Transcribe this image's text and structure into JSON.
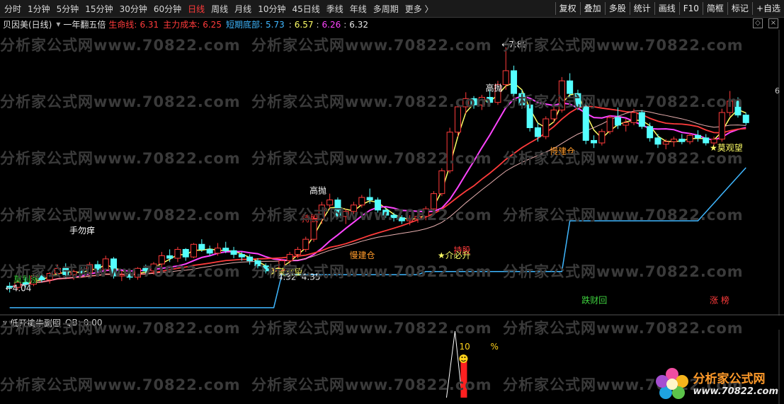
{
  "toolbar": {
    "periods": [
      "分时",
      "1分钟",
      "5分钟",
      "15分钟",
      "30分钟",
      "60分钟",
      "日线",
      "周线",
      "月线",
      "10分钟",
      "45日线",
      "季线",
      "年线",
      "多周期",
      "更多 〉"
    ],
    "active_period": "日线",
    "tools": [
      "复权",
      "叠加",
      "多股",
      "统计",
      "画线",
      "F10",
      "简框",
      "标记",
      "+自选"
    ]
  },
  "legend": {
    "title": "贝因美(日线)",
    "indicator": "一年翻五倍",
    "items": [
      {
        "label": "生命线:",
        "value": "6.31",
        "color": "#ff3b3b"
      },
      {
        "label": "主力成本:",
        "value": "6.25",
        "color": "#ff3b3b"
      },
      {
        "label": "短期底部:",
        "value": "5.73",
        "color": "#3fb7ff"
      }
    ],
    "extra_values": [
      {
        "value": "6.57",
        "color": "#ffff66"
      },
      {
        "value": "6.26",
        "color": "#ff44ff"
      },
      {
        "value": "6.32",
        "color": "#e8e8e8"
      }
    ]
  },
  "sub_legend": {
    "title": "低开擒牛副图",
    "label": "QB:",
    "value": "0.00"
  },
  "watermark": "分析家公式网www.70822.com",
  "logo": {
    "name": "分析家公式网",
    "url": "www.70822.com"
  },
  "right_axis_label": "6",
  "chart_data": {
    "type": "candlestick",
    "ylim": [
      3.7,
      8.1
    ],
    "candles": [
      [
        4.12,
        4.18,
        4.02,
        4.1
      ],
      [
        4.1,
        4.22,
        4.06,
        4.18
      ],
      [
        4.18,
        4.26,
        4.1,
        4.15
      ],
      [
        4.15,
        4.3,
        4.12,
        4.28
      ],
      [
        4.28,
        4.36,
        4.18,
        4.22
      ],
      [
        4.22,
        4.34,
        4.16,
        4.32
      ],
      [
        4.32,
        4.46,
        4.28,
        4.4
      ],
      [
        4.4,
        4.48,
        4.24,
        4.3
      ],
      [
        4.3,
        4.38,
        4.22,
        4.35
      ],
      [
        4.35,
        4.42,
        4.28,
        4.33
      ],
      [
        4.33,
        4.5,
        4.3,
        4.46
      ],
      [
        4.46,
        4.52,
        4.34,
        4.38
      ],
      [
        4.38,
        4.6,
        4.34,
        4.55
      ],
      [
        4.55,
        4.58,
        4.24,
        4.28
      ],
      [
        4.28,
        4.36,
        4.2,
        4.3
      ],
      [
        4.3,
        4.34,
        4.22,
        4.26
      ],
      [
        4.26,
        4.42,
        4.22,
        4.4
      ],
      [
        4.4,
        4.46,
        4.32,
        4.36
      ],
      [
        4.36,
        4.5,
        4.3,
        4.47
      ],
      [
        4.47,
        4.66,
        4.42,
        4.6
      ],
      [
        4.6,
        4.7,
        4.5,
        4.56
      ],
      [
        4.56,
        4.74,
        4.5,
        4.7
      ],
      [
        4.7,
        4.72,
        4.52,
        4.58
      ],
      [
        4.58,
        4.8,
        4.56,
        4.78
      ],
      [
        4.78,
        4.86,
        4.66,
        4.7
      ],
      [
        4.7,
        4.76,
        4.6,
        4.64
      ],
      [
        4.64,
        4.8,
        4.6,
        4.72
      ],
      [
        4.72,
        4.82,
        4.64,
        4.68
      ],
      [
        4.68,
        4.74,
        4.56,
        4.62
      ],
      [
        4.62,
        4.66,
        4.52,
        4.58
      ],
      [
        4.58,
        4.62,
        4.46,
        4.52
      ],
      [
        4.52,
        4.56,
        4.4,
        4.44
      ],
      [
        4.44,
        4.48,
        4.32,
        4.36
      ],
      [
        4.36,
        4.4,
        4.28,
        4.37
      ],
      [
        4.37,
        4.55,
        4.35,
        4.52
      ],
      [
        4.52,
        4.66,
        4.48,
        4.62
      ],
      [
        4.62,
        4.74,
        4.56,
        4.7
      ],
      [
        4.7,
        4.9,
        4.66,
        4.86
      ],
      [
        4.86,
        5.22,
        4.82,
        5.18
      ],
      [
        5.18,
        5.45,
        5.1,
        5.4
      ],
      [
        5.4,
        5.58,
        5.34,
        5.48
      ],
      [
        5.48,
        5.52,
        5.18,
        5.22
      ],
      [
        5.22,
        5.34,
        5.1,
        5.3
      ],
      [
        5.3,
        5.45,
        5.26,
        5.4
      ],
      [
        5.4,
        5.56,
        5.36,
        5.52
      ],
      [
        5.52,
        5.66,
        5.42,
        5.48
      ],
      [
        5.48,
        5.52,
        5.28,
        5.32
      ],
      [
        5.32,
        5.36,
        5.2,
        5.24
      ],
      [
        5.24,
        5.28,
        5.14,
        5.2
      ],
      [
        5.2,
        5.24,
        5.1,
        5.15
      ],
      [
        5.15,
        5.24,
        5.08,
        5.18
      ],
      [
        5.18,
        5.26,
        5.12,
        5.22
      ],
      [
        5.22,
        5.38,
        5.16,
        5.34
      ],
      [
        5.34,
        5.62,
        5.3,
        5.58
      ],
      [
        5.58,
        5.98,
        5.54,
        5.94
      ],
      [
        5.94,
        6.62,
        5.9,
        6.55
      ],
      [
        6.55,
        7.02,
        6.48,
        6.95
      ],
      [
        6.95,
        7.18,
        6.84,
        7.08
      ],
      [
        7.08,
        7.12,
        6.92,
        6.98
      ],
      [
        6.98,
        7.14,
        6.9,
        7.1
      ],
      [
        7.1,
        7.22,
        6.96,
        7.02
      ],
      [
        7.02,
        7.36,
        6.98,
        7.3
      ],
      [
        7.3,
        7.89,
        7.22,
        7.52
      ],
      [
        7.52,
        7.6,
        7.1,
        7.16
      ],
      [
        7.16,
        7.22,
        6.92,
        6.98
      ],
      [
        6.98,
        7.04,
        6.56,
        6.62
      ],
      [
        6.62,
        6.7,
        6.4,
        6.48
      ],
      [
        6.48,
        6.8,
        6.44,
        6.76
      ],
      [
        6.76,
        6.96,
        6.7,
        6.9
      ],
      [
        6.9,
        7.42,
        6.86,
        7.36
      ],
      [
        7.36,
        7.48,
        7.1,
        7.16
      ],
      [
        7.16,
        7.22,
        6.9,
        6.95
      ],
      [
        6.95,
        7.0,
        6.36,
        6.42
      ],
      [
        6.42,
        6.5,
        6.3,
        6.38
      ],
      [
        6.38,
        6.6,
        6.34,
        6.56
      ],
      [
        6.56,
        6.82,
        6.52,
        6.78
      ],
      [
        6.78,
        6.94,
        6.6,
        6.66
      ],
      [
        6.66,
        6.76,
        6.56,
        6.7
      ],
      [
        6.7,
        6.92,
        6.66,
        6.86
      ],
      [
        6.86,
        6.9,
        6.6,
        6.64
      ],
      [
        6.64,
        6.7,
        6.4,
        6.46
      ],
      [
        6.46,
        6.52,
        6.3,
        6.36
      ],
      [
        6.36,
        6.44,
        6.28,
        6.4
      ],
      [
        6.4,
        6.48,
        6.32,
        6.44
      ],
      [
        6.44,
        6.52,
        6.36,
        6.4
      ],
      [
        6.4,
        6.54,
        6.36,
        6.5
      ],
      [
        6.5,
        6.58,
        6.4,
        6.46
      ],
      [
        6.46,
        6.52,
        6.34,
        6.38
      ],
      [
        6.38,
        6.48,
        6.34,
        6.44
      ],
      [
        6.44,
        6.92,
        6.4,
        6.86
      ],
      [
        6.86,
        7.2,
        6.8,
        7.04
      ],
      [
        7.04,
        7.1,
        6.78,
        6.82
      ],
      [
        6.82,
        6.86,
        6.66,
        6.7
      ]
    ],
    "labels": [
      {
        "text": "手勿痒",
        "i": 8,
        "y": 4.95,
        "color": "#ffffff"
      },
      {
        "text": "莫到涨",
        "i": 1,
        "y": 4.18,
        "color": "#3fd43f"
      },
      {
        "text": "←4.04",
        "i": 0,
        "y": 4.04,
        "color": "#e8e8e8"
      },
      {
        "text": "高抛",
        "i": 38,
        "y": 5.58,
        "color": "#ffffff"
      },
      {
        "text": "持股",
        "i": 37,
        "y": 5.14,
        "color": "#ff3b3b"
      },
      {
        "text": "★莫观望",
        "i": 33,
        "y": 4.3,
        "color": "#ffff66"
      },
      {
        "text": "4.32",
        "i": 34,
        "y": 4.22,
        "color": "#e8e8e8"
      },
      {
        "text": "4.35",
        "i": 37,
        "y": 4.22,
        "color": "#e8e8e8"
      },
      {
        "text": "慢建仓",
        "i": 43,
        "y": 4.56,
        "color": "#ff9a2a"
      },
      {
        "text": "持股",
        "i": 56,
        "y": 4.64,
        "color": "#ff3b3b"
      },
      {
        "text": "★介必升",
        "i": 54,
        "y": 4.56,
        "color": "#ffff66"
      },
      {
        "text": "高抛",
        "i": 60,
        "y": 7.2,
        "color": "#ffffff"
      },
      {
        "text": "←7.89",
        "i": 62,
        "y": 7.89,
        "color": "#e8e8e8"
      },
      {
        "text": "慢建仓",
        "i": 68,
        "y": 6.2,
        "color": "#ff9a2a"
      },
      {
        "text": "★莫观望",
        "i": 88,
        "y": 6.26,
        "color": "#ffff66"
      },
      {
        "text": "跌财回",
        "i": 72,
        "y": 3.85,
        "color": "#3fd43f"
      },
      {
        "text": "涨 榜",
        "i": 88,
        "y": 3.85,
        "color": "#ff3b3b"
      }
    ],
    "sub": {
      "peak_i": 56,
      "value_label": "10",
      "unit_label": "%"
    }
  }
}
